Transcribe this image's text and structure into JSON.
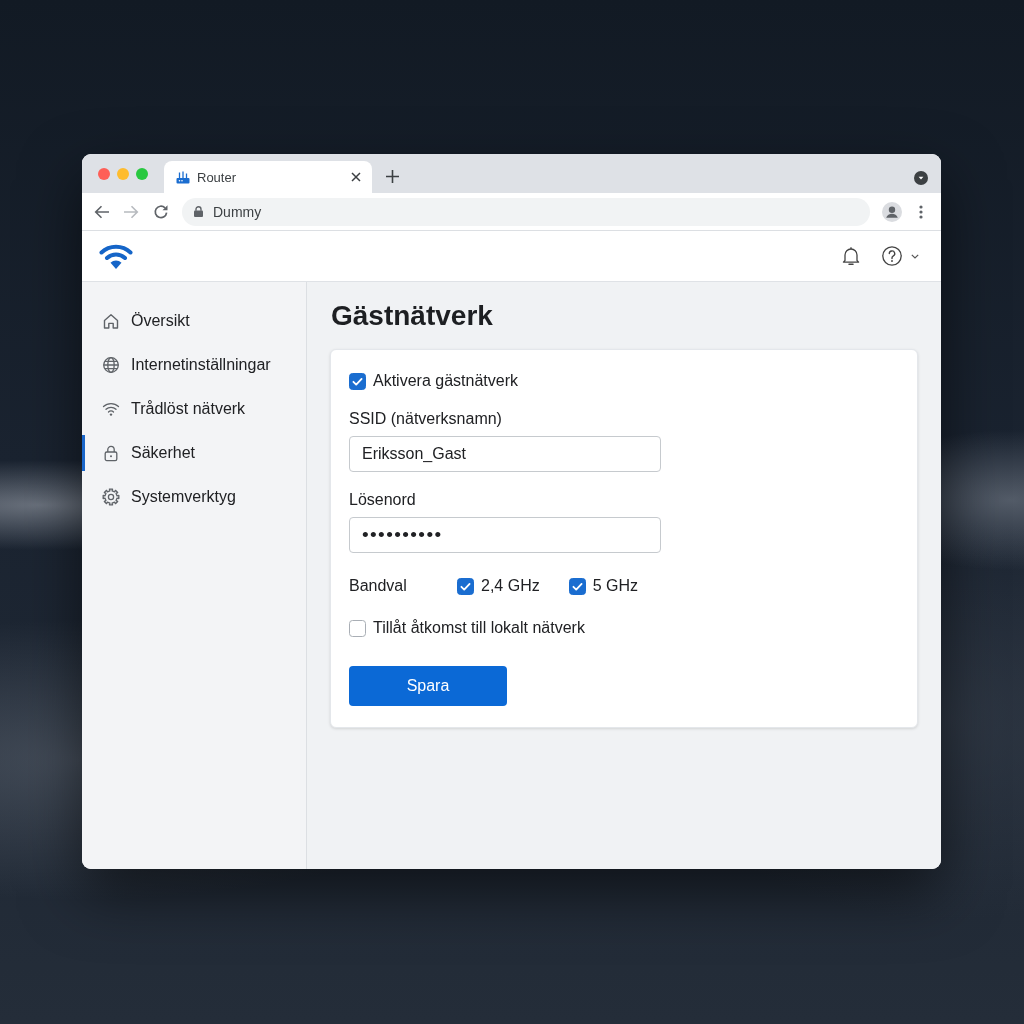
{
  "browser": {
    "tab": {
      "title": "Router"
    },
    "navigation": {
      "back": {
        "disabled": false
      },
      "forward": {
        "disabled": true
      }
    },
    "address_bar": {
      "url": "Dummy"
    }
  },
  "sidebar": {
    "items": [
      {
        "label": "Översikt",
        "selected": false
      },
      {
        "label": "Internetinställningar",
        "selected": false
      },
      {
        "label": "Trådlöst nätverk",
        "selected": false
      },
      {
        "label": "Säkerhet",
        "selected": true
      },
      {
        "label": "Systemverktyg",
        "selected": false
      }
    ]
  },
  "page": {
    "title": "Gästnätverk"
  },
  "form": {
    "enable_guest": {
      "label": "Aktivera gästnätverk",
      "checked": true
    },
    "ssid": {
      "label": "SSID (nätverksnamn)",
      "value": "Eriksson_Gast"
    },
    "password": {
      "label": "Lösenord",
      "value": "••••••••••"
    },
    "band": {
      "label": "Bandval",
      "options": [
        {
          "label": "2,4 GHz",
          "checked": true
        },
        {
          "label": "5 GHz",
          "checked": true
        }
      ]
    },
    "local_access": {
      "label": "Tillåt åtkomst till lokalt nätverk",
      "checked": false
    },
    "save_button": "Spara"
  }
}
